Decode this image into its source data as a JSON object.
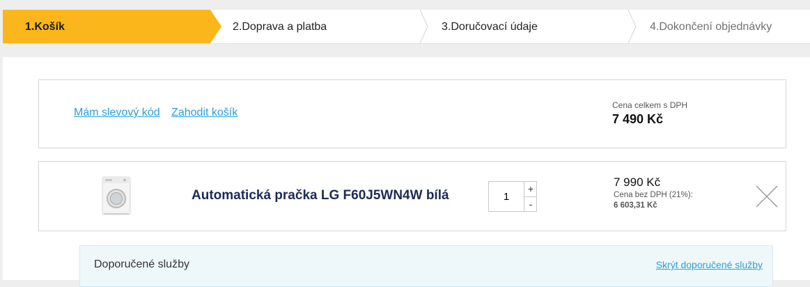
{
  "steps": [
    {
      "label": "1.Košík",
      "state": "active"
    },
    {
      "label": "2.Doprava a platba",
      "state": "normal"
    },
    {
      "label": "3.Doručovací údaje",
      "state": "normal"
    },
    {
      "label": "4.Dokončení objednávky",
      "state": "disabled"
    }
  ],
  "colors": {
    "accent": "#fbb61b",
    "link": "#2a9fd6",
    "product_name": "#1c2b57",
    "services_bg": "#eef8fb"
  },
  "cart": {
    "discount_link": "Mám slevový kód",
    "discard_link": "Zahodit košík",
    "total_label": "Cena celkem s DPH",
    "total_value": "7 490 Kč"
  },
  "item": {
    "image_icon": "washing-machine-icon",
    "name": "Automatická pračka LG F60J5WN4W bílá",
    "quantity": "1",
    "plus_label": "+",
    "minus_label": "-",
    "price": "7 990 Kč",
    "price_ex_vat_label": "Cena bez DPH (21%):",
    "price_ex_vat_value": "6 603,31 Kč",
    "remove_icon": "close-icon"
  },
  "services": {
    "title": "Doporučené služby",
    "hide_link": "Skrýt doporučené služby"
  }
}
